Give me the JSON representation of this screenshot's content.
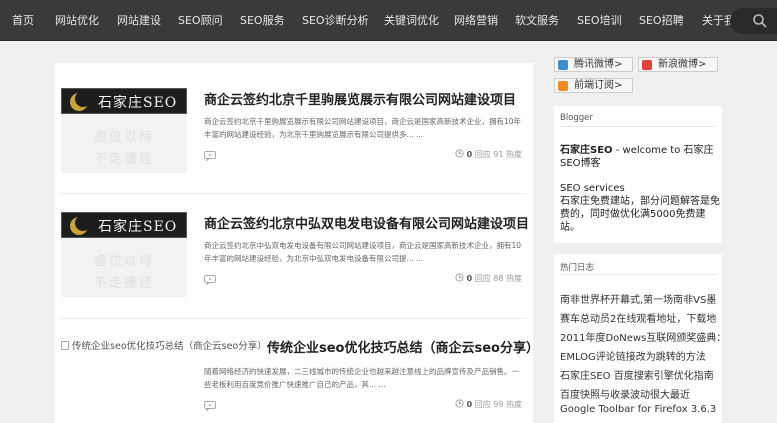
{
  "nav": {
    "items": [
      "首页",
      "网站优化",
      "网站建设",
      "SEO顾问",
      "SEO服务",
      "SEO诊断分析",
      "关键词优化",
      "网络营销",
      "软文服务",
      "SEO培训",
      "SEO招聘",
      "关于我"
    ]
  },
  "posts": [
    {
      "title": "商企云签约北京千里驹展览展示有限公司网站建设项目",
      "excerpt": "商企云签约北京千里驹展览展示有限公司网站建设项目，商企云是国家高新技术企业，拥有10年丰富的网站建设经验，为北京千里驹展览展示有限公司提供多... ...",
      "comments": "0",
      "comments_label": "回应",
      "heat": "91 热度",
      "thumb_logo": "石家庄SEO",
      "thumb_wm1": "虚位以待",
      "thumb_wm2": "不走捷径"
    },
    {
      "title": "商企云签约北京中弘双电发电设备有限公司网站建设项目",
      "excerpt": "商企云签约北京中弘双电发电设备有限公司网站建设项目，商企云是国家高新技术企业，拥有10年丰富的网站建设经验，为北京中弘双电发电设备有限公司提... ...",
      "comments": "0",
      "comments_label": "回应",
      "heat": "88 热度",
      "thumb_logo": "石家庄SEO",
      "thumb_wm1": "虚位以待",
      "thumb_wm2": "不走捷径"
    },
    {
      "title": "传统企业seo优化技巧总结（商企云seo分享）",
      "image_alt": "传统企业seo优化技巧总结（商企云seo分享）",
      "excerpt": "随着网络经济的快速发展，二三线城市的传统企业也越来越注意线上的品牌宣传及产品销售。一些老板利用百度竞价推广快速推广自己的产品，其... ...",
      "comments": "0",
      "comments_label": "回应",
      "heat": "99 热度"
    }
  ],
  "social": {
    "tencent": "腾讯微博>",
    "sina": "新浪微博>",
    "rss": "前端订阅>"
  },
  "blogger": {
    "title": "Blogger",
    "name_bold": "石家庄SEO",
    "name_rest": " - welcome to 石家庄SEO博客",
    "services_head": "SEO services",
    "services_text": "石家庄免费建站，部分问题解答是免费的，同时做优化满5000免费建站。"
  },
  "hot": {
    "title": "热门日志",
    "items": [
      "南非世界杯开幕式,第一场南非VS墨",
      "赛车总动员2在线观看地址，下载地",
      "2011年度DoNews互联网颁奖盛典：",
      "EMLOG评论链接改为跳转的方法",
      "石家庄SEO 百度搜索引擎优化指南",
      "百度快照与收录波动很大最近",
      "Google Toolbar for Firefox 3.6.3"
    ]
  },
  "colors": {
    "nav_bg": "#3a3a3a",
    "page_bg": "#f0f0f0",
    "tencent": "#3b8fd1",
    "sina": "#e0413a",
    "rss": "#f08a24"
  }
}
